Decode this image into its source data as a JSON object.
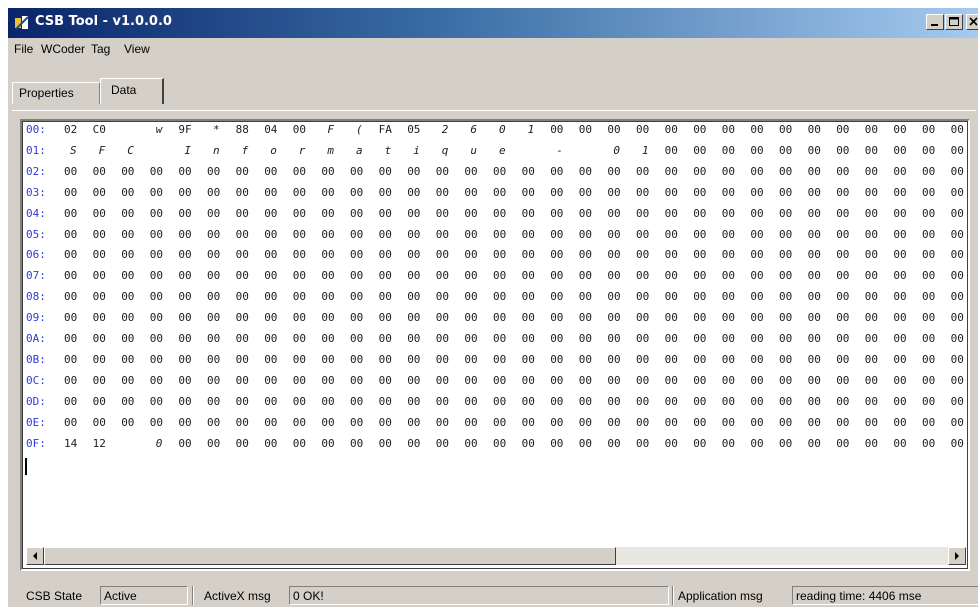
{
  "window": {
    "title": "CSB Tool - v1.0.0.0",
    "icons": {
      "app": "app-icon",
      "minimize": "minimize-icon",
      "maximize": "maximize-icon",
      "close": "close-icon"
    }
  },
  "menu": [
    "File",
    "WCoder",
    "Tag",
    "View"
  ],
  "tabs": {
    "properties": "Properties",
    "data": "Data",
    "active": "Data"
  },
  "hex_rows": [
    {
      "label": "00:",
      "cells": [
        "02",
        "C0",
        "",
        "w",
        "9F",
        "*",
        "88",
        "04",
        "00",
        "F",
        "(",
        "FA",
        "05",
        "2",
        "6",
        "0",
        "1",
        "00",
        "00",
        "00",
        "00",
        "00",
        "00",
        "00",
        "00",
        "00",
        "00",
        "00",
        "00",
        "00",
        "00",
        "00"
      ]
    },
    {
      "label": "01:",
      "cells": [
        "S",
        "F",
        "C",
        "",
        "I",
        "n",
        "f",
        "o",
        "r",
        "m",
        "a",
        "t",
        "i",
        "q",
        "u",
        "e",
        "",
        "-",
        "",
        "0",
        "1",
        "00",
        "00",
        "00",
        "00",
        "00",
        "00",
        "00",
        "00",
        "00",
        "00",
        "00"
      ]
    },
    {
      "label": "02:",
      "cells": [
        "00",
        "00",
        "00",
        "00",
        "00",
        "00",
        "00",
        "00",
        "00",
        "00",
        "00",
        "00",
        "00",
        "00",
        "00",
        "00",
        "00",
        "00",
        "00",
        "00",
        "00",
        "00",
        "00",
        "00",
        "00",
        "00",
        "00",
        "00",
        "00",
        "00",
        "00",
        "00"
      ]
    },
    {
      "label": "03:",
      "cells": [
        "00",
        "00",
        "00",
        "00",
        "00",
        "00",
        "00",
        "00",
        "00",
        "00",
        "00",
        "00",
        "00",
        "00",
        "00",
        "00",
        "00",
        "00",
        "00",
        "00",
        "00",
        "00",
        "00",
        "00",
        "00",
        "00",
        "00",
        "00",
        "00",
        "00",
        "00",
        "00"
      ]
    },
    {
      "label": "04:",
      "cells": [
        "00",
        "00",
        "00",
        "00",
        "00",
        "00",
        "00",
        "00",
        "00",
        "00",
        "00",
        "00",
        "00",
        "00",
        "00",
        "00",
        "00",
        "00",
        "00",
        "00",
        "00",
        "00",
        "00",
        "00",
        "00",
        "00",
        "00",
        "00",
        "00",
        "00",
        "00",
        "00"
      ]
    },
    {
      "label": "05:",
      "cells": [
        "00",
        "00",
        "00",
        "00",
        "00",
        "00",
        "00",
        "00",
        "00",
        "00",
        "00",
        "00",
        "00",
        "00",
        "00",
        "00",
        "00",
        "00",
        "00",
        "00",
        "00",
        "00",
        "00",
        "00",
        "00",
        "00",
        "00",
        "00",
        "00",
        "00",
        "00",
        "00"
      ]
    },
    {
      "label": "06:",
      "cells": [
        "00",
        "00",
        "00",
        "00",
        "00",
        "00",
        "00",
        "00",
        "00",
        "00",
        "00",
        "00",
        "00",
        "00",
        "00",
        "00",
        "00",
        "00",
        "00",
        "00",
        "00",
        "00",
        "00",
        "00",
        "00",
        "00",
        "00",
        "00",
        "00",
        "00",
        "00",
        "00"
      ]
    },
    {
      "label": "07:",
      "cells": [
        "00",
        "00",
        "00",
        "00",
        "00",
        "00",
        "00",
        "00",
        "00",
        "00",
        "00",
        "00",
        "00",
        "00",
        "00",
        "00",
        "00",
        "00",
        "00",
        "00",
        "00",
        "00",
        "00",
        "00",
        "00",
        "00",
        "00",
        "00",
        "00",
        "00",
        "00",
        "00"
      ]
    },
    {
      "label": "08:",
      "cells": [
        "00",
        "00",
        "00",
        "00",
        "00",
        "00",
        "00",
        "00",
        "00",
        "00",
        "00",
        "00",
        "00",
        "00",
        "00",
        "00",
        "00",
        "00",
        "00",
        "00",
        "00",
        "00",
        "00",
        "00",
        "00",
        "00",
        "00",
        "00",
        "00",
        "00",
        "00",
        "00"
      ]
    },
    {
      "label": "09:",
      "cells": [
        "00",
        "00",
        "00",
        "00",
        "00",
        "00",
        "00",
        "00",
        "00",
        "00",
        "00",
        "00",
        "00",
        "00",
        "00",
        "00",
        "00",
        "00",
        "00",
        "00",
        "00",
        "00",
        "00",
        "00",
        "00",
        "00",
        "00",
        "00",
        "00",
        "00",
        "00",
        "00"
      ]
    },
    {
      "label": "0A:",
      "cells": [
        "00",
        "00",
        "00",
        "00",
        "00",
        "00",
        "00",
        "00",
        "00",
        "00",
        "00",
        "00",
        "00",
        "00",
        "00",
        "00",
        "00",
        "00",
        "00",
        "00",
        "00",
        "00",
        "00",
        "00",
        "00",
        "00",
        "00",
        "00",
        "00",
        "00",
        "00",
        "00"
      ]
    },
    {
      "label": "0B:",
      "cells": [
        "00",
        "00",
        "00",
        "00",
        "00",
        "00",
        "00",
        "00",
        "00",
        "00",
        "00",
        "00",
        "00",
        "00",
        "00",
        "00",
        "00",
        "00",
        "00",
        "00",
        "00",
        "00",
        "00",
        "00",
        "00",
        "00",
        "00",
        "00",
        "00",
        "00",
        "00",
        "00"
      ]
    },
    {
      "label": "0C:",
      "cells": [
        "00",
        "00",
        "00",
        "00",
        "00",
        "00",
        "00",
        "00",
        "00",
        "00",
        "00",
        "00",
        "00",
        "00",
        "00",
        "00",
        "00",
        "00",
        "00",
        "00",
        "00",
        "00",
        "00",
        "00",
        "00",
        "00",
        "00",
        "00",
        "00",
        "00",
        "00",
        "00"
      ]
    },
    {
      "label": "0D:",
      "cells": [
        "00",
        "00",
        "00",
        "00",
        "00",
        "00",
        "00",
        "00",
        "00",
        "00",
        "00",
        "00",
        "00",
        "00",
        "00",
        "00",
        "00",
        "00",
        "00",
        "00",
        "00",
        "00",
        "00",
        "00",
        "00",
        "00",
        "00",
        "00",
        "00",
        "00",
        "00",
        "00"
      ]
    },
    {
      "label": "0E:",
      "cells": [
        "00",
        "00",
        "00",
        "00",
        "00",
        "00",
        "00",
        "00",
        "00",
        "00",
        "00",
        "00",
        "00",
        "00",
        "00",
        "00",
        "00",
        "00",
        "00",
        "00",
        "00",
        "00",
        "00",
        "00",
        "00",
        "00",
        "00",
        "00",
        "00",
        "00",
        "00",
        "00"
      ]
    },
    {
      "label": "0F:",
      "cells": [
        "14",
        "12",
        "",
        "0",
        "00",
        "00",
        "00",
        "00",
        "00",
        "00",
        "00",
        "00",
        "00",
        "00",
        "00",
        "00",
        "00",
        "00",
        "00",
        "00",
        "00",
        "00",
        "00",
        "00",
        "00",
        "00",
        "00",
        "00",
        "00",
        "00",
        "00",
        "00"
      ]
    }
  ],
  "scrollbar": {
    "left_icon": "scroll-left-icon",
    "right_icon": "scroll-right-icon",
    "position": 0
  },
  "status": {
    "state_label": "CSB State",
    "state_value": "Active",
    "activex_label": "ActiveX msg",
    "activex_value": "0 OK!",
    "app_label": "Application msg",
    "app_value": "reading time: 4406 mse"
  },
  "colors": {
    "titlebar": "#0a246a",
    "row_label": "#2b3bd9",
    "face": "#d4d0c8"
  }
}
